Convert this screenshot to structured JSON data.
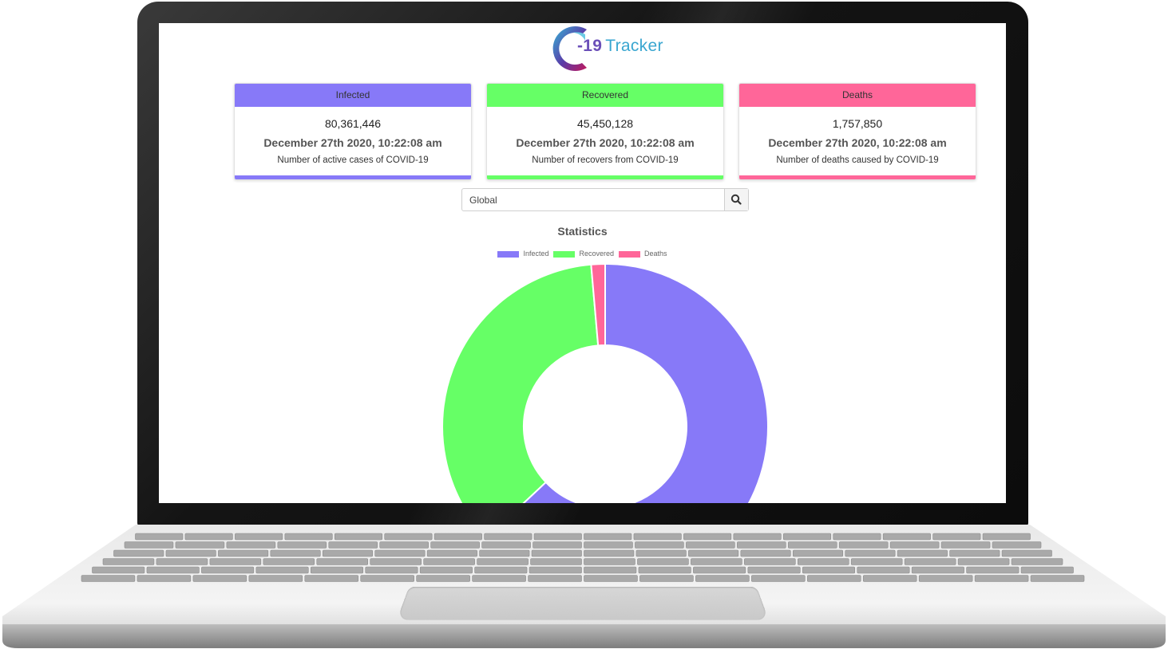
{
  "logo": {
    "number": "-19",
    "word": "Tracker"
  },
  "cards": [
    {
      "id": "infected",
      "title": "Infected",
      "count": "80,361,446",
      "date": "December 27th 2020, 10:22:08 am",
      "desc": "Number of active cases of COVID-19",
      "color": "#8779f8"
    },
    {
      "id": "recovered",
      "title": "Recovered",
      "count": "45,450,128",
      "date": "December 27th 2020, 10:22:08 am",
      "desc": "Number of recovers from COVID-19",
      "color": "#66ff66"
    },
    {
      "id": "deaths",
      "title": "Deaths",
      "count": "1,757,850",
      "date": "December 27th 2020, 10:22:08 am",
      "desc": "Number of deaths caused by COVID-19",
      "color": "#ff6699"
    }
  ],
  "search": {
    "value": "Global",
    "icon": "search-icon"
  },
  "chart_data": {
    "type": "pie",
    "title": "Statistics",
    "categories": [
      "Infected",
      "Recovered",
      "Deaths"
    ],
    "values": [
      80361446,
      45450128,
      1757850
    ],
    "colors": [
      "#8779f8",
      "#66ff66",
      "#ff6699"
    ],
    "legend": "top",
    "donut": true
  }
}
